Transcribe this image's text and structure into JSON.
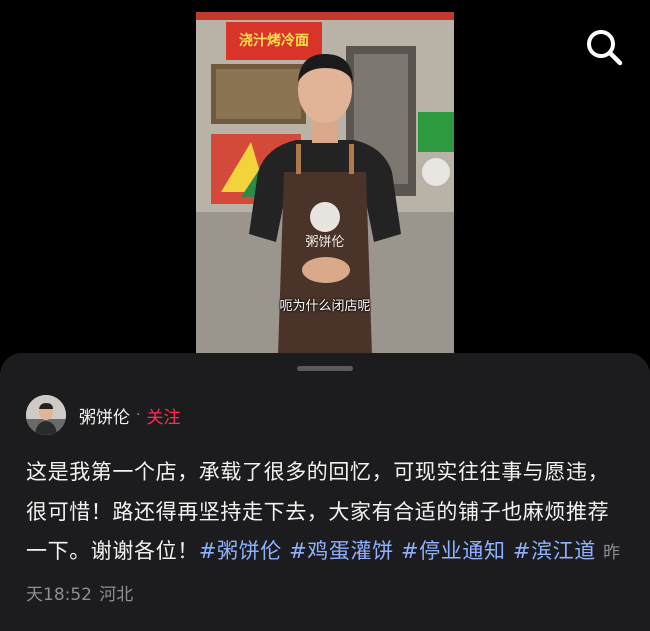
{
  "video": {
    "subtitle": "呃为什么闭店呢",
    "shop_sign": "浇汁烤冷面",
    "apron_text": "粥饼伦"
  },
  "header": {
    "search_icon": "search-icon"
  },
  "author": {
    "name": "粥饼伦",
    "separator": "·",
    "follow_label": "关注"
  },
  "post": {
    "caption": "这是我第一个店，承载了很多的回忆，可现实往往事与愿违，很可惜！路还得再坚持走下去，大家有合适的铺子也麻烦推荐一下。谢谢各位！",
    "hashtags": [
      "#粥饼伦",
      "#鸡蛋灌饼",
      "#停业通知",
      "#滨江道"
    ],
    "time": "昨天18:52",
    "location": "河北"
  },
  "colors": {
    "accent_follow": "#fe2c55",
    "hashtag": "#8fb1ff",
    "sheet_bg": "#1c1c1e",
    "meta": "#8e8e93"
  }
}
